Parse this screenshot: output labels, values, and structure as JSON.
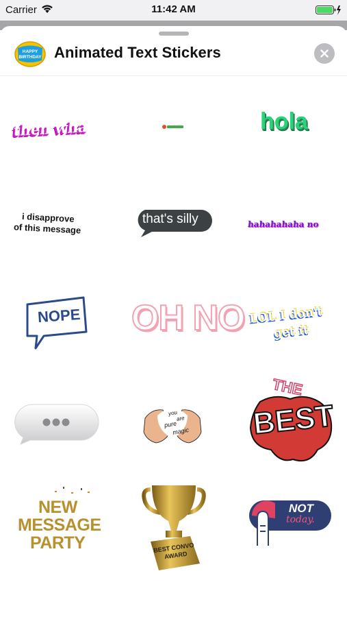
{
  "status_bar": {
    "carrier": "Carrier",
    "time": "11:42 AM"
  },
  "sheet": {
    "title": "Animated Text Stickers",
    "close_icon": "close-x-icon"
  },
  "stickers": {
    "then_wha": "then wha",
    "hola": "hola",
    "disapprove": [
      "i disapprove",
      "of this message"
    ],
    "thats_silly": "that's silly",
    "hahaha": "hahahahaha no",
    "nope": "NOPE",
    "oh_no": "OH NO",
    "lol": [
      "LOL I don't",
      "get it"
    ],
    "love": [
      "you",
      "are",
      "pure",
      "magic"
    ],
    "best": [
      "THE",
      "BEST"
    ],
    "new_message": [
      "NEW",
      "MESSAGE",
      "PARTY"
    ],
    "award": [
      "BEST CONVO",
      "AWARD"
    ],
    "not_today": [
      "NOT",
      "today."
    ]
  },
  "colors": {
    "accent_magenta": "#d21dcf",
    "hola_green": "#2fd07a",
    "nope_blue": "#2a4a8c",
    "pink": "#f2a3b1",
    "gold": "#b8912e",
    "red": "#d13a35"
  }
}
